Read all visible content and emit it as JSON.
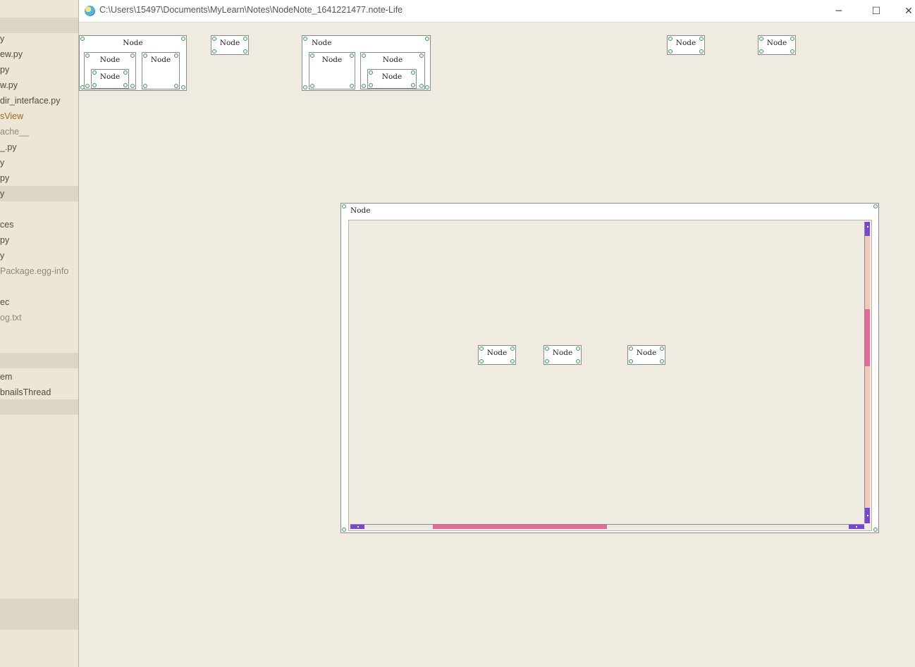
{
  "sidebar": {
    "items": [
      {
        "label": "y",
        "style": "normal"
      },
      {
        "label": "ew.py",
        "style": "normal"
      },
      {
        "label": "py",
        "style": "normal"
      },
      {
        "label": "w.py",
        "style": "normal"
      },
      {
        "label": "dir_interface.py",
        "style": "normal"
      },
      {
        "label": "sView",
        "style": "accent"
      },
      {
        "label": "ache__",
        "style": "dim"
      },
      {
        "label": "_.py",
        "style": "normal"
      },
      {
        "label": "y",
        "style": "normal"
      },
      {
        "label": "py",
        "style": "normal"
      },
      {
        "label": "y",
        "style": "selected"
      },
      {
        "label": "ces",
        "style": "normal"
      },
      {
        "label": "py",
        "style": "normal"
      },
      {
        "label": "y",
        "style": "normal"
      },
      {
        "label": "Package.egg-info",
        "style": "dim"
      },
      {
        "label": "ec",
        "style": "normal"
      },
      {
        "label": "og.txt",
        "style": "dim"
      },
      {
        "label": "em",
        "style": "normal"
      },
      {
        "label": "bnailsThread",
        "style": "normal"
      }
    ]
  },
  "window": {
    "title": "C:\\Users\\15497\\Documents\\MyLearn\\Notes\\NodeNote_1641221477.note-Life",
    "icon": "app-globe-icon",
    "minimize_icon": "─",
    "maximize_icon": "☐",
    "close_icon": "✕"
  },
  "nodes": {
    "label": "Node"
  },
  "big_node": {
    "vertical_scroll": {
      "thumb_start": 0.29,
      "thumb_end": 0.48
    },
    "horizontal_scroll": {
      "thumb_start": 0.16,
      "thumb_end": 0.5
    }
  },
  "colors": {
    "canvas_bg": "#efebe1",
    "port_border": "#4a9a6a",
    "scroll_thumb": "#e6699a",
    "scroll_track": "#f2c8b8",
    "scroll_arrow": "#7a44d6"
  }
}
